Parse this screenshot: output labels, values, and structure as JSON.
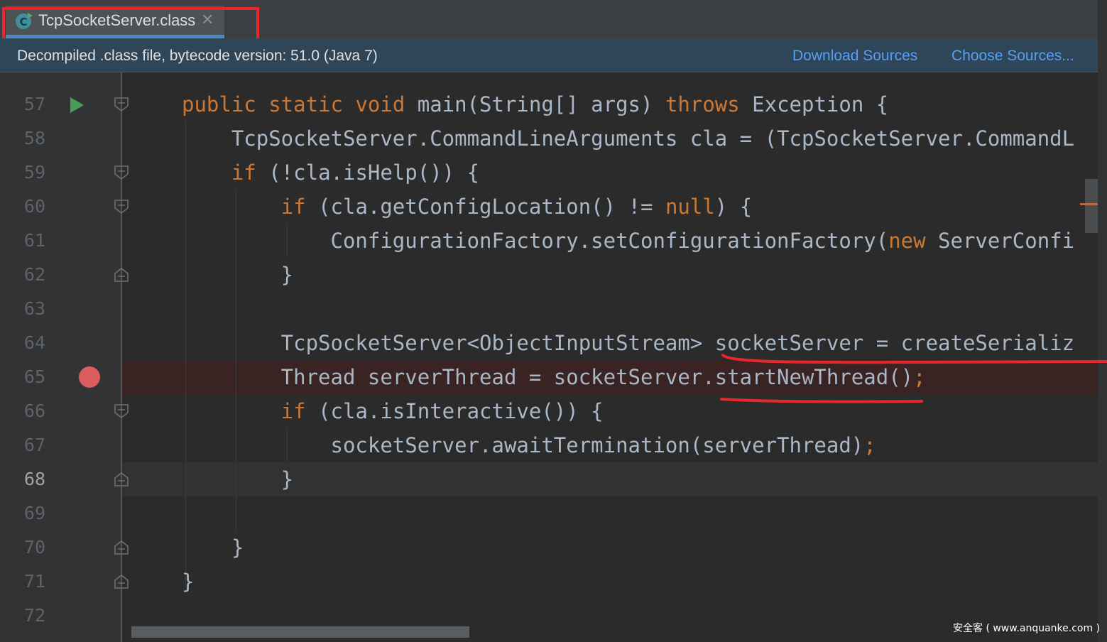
{
  "tab": {
    "title": "TcpSocketServer.class",
    "close_glyph": "✕",
    "icon": "java-class-icon"
  },
  "banner": {
    "text": "Decompiled .class file, bytecode version: 51.0 (Java 7)",
    "download_sources": "Download Sources",
    "choose_sources": "Choose Sources..."
  },
  "editor": {
    "current_line": "68",
    "breakpoint_line": "65",
    "lines": [
      {
        "num": "57",
        "tokens": [
          {
            "k": "kw",
            "t": "public "
          },
          {
            "k": "kw",
            "t": "static "
          },
          {
            "k": "kw",
            "t": "void "
          },
          {
            "k": "ident",
            "t": "main(String[] args) "
          },
          {
            "k": "kw",
            "t": "throws "
          },
          {
            "k": "ident",
            "t": "Exception {"
          }
        ]
      },
      {
        "num": "58",
        "tokens": [
          {
            "k": "ident",
            "t": "    TcpSocketServer.CommandLineArguments cla = (TcpSocketServer.CommandL"
          }
        ]
      },
      {
        "num": "59",
        "tokens": [
          {
            "k": "ident",
            "t": "    "
          },
          {
            "k": "kw",
            "t": "if "
          },
          {
            "k": "ident",
            "t": "(!cla.isHelp()) {"
          }
        ]
      },
      {
        "num": "60",
        "tokens": [
          {
            "k": "ident",
            "t": "        "
          },
          {
            "k": "kw",
            "t": "if "
          },
          {
            "k": "ident",
            "t": "(cla.getConfigLocation() != "
          },
          {
            "k": "kw",
            "t": "null"
          },
          {
            "k": "ident",
            "t": ") {"
          }
        ]
      },
      {
        "num": "61",
        "tokens": [
          {
            "k": "ident",
            "t": "            ConfigurationFactory.setConfigurationFactory("
          },
          {
            "k": "kw",
            "t": "new "
          },
          {
            "k": "ident",
            "t": "ServerConfi"
          }
        ]
      },
      {
        "num": "62",
        "tokens": [
          {
            "k": "ident",
            "t": "        }"
          }
        ]
      },
      {
        "num": "63",
        "tokens": []
      },
      {
        "num": "64",
        "tokens": [
          {
            "k": "ident",
            "t": "        TcpSocketServer<ObjectInputStream> socketServer = createSerializ"
          }
        ]
      },
      {
        "num": "65",
        "tokens": [
          {
            "k": "ident",
            "t": "        Thread serverThread = socketServer.startNewThread()"
          },
          {
            "k": "kw",
            "t": ";"
          }
        ]
      },
      {
        "num": "66",
        "tokens": [
          {
            "k": "ident",
            "t": "        "
          },
          {
            "k": "kw",
            "t": "if "
          },
          {
            "k": "ident",
            "t": "(cla.isInteractive()) {"
          }
        ]
      },
      {
        "num": "67",
        "tokens": [
          {
            "k": "ident",
            "t": "            socketServer.awaitTermination(serverThread)"
          },
          {
            "k": "kw",
            "t": ";"
          }
        ]
      },
      {
        "num": "68",
        "tokens": [
          {
            "k": "ident",
            "t": "        }"
          }
        ]
      },
      {
        "num": "69",
        "tokens": []
      },
      {
        "num": "70",
        "tokens": [
          {
            "k": "ident",
            "t": "    }"
          }
        ]
      },
      {
        "num": "71",
        "tokens": [
          {
            "k": "ident",
            "t": "}"
          }
        ]
      },
      {
        "num": "72",
        "tokens": []
      }
    ]
  },
  "watermark": "安全客 ( www.anquanke.com )",
  "colors": {
    "keyword": "#cc7832",
    "identifier": "#a9b7c6",
    "annotation_red": "#e8262d",
    "link": "#589df6",
    "breakpoint": "#db5c5c"
  }
}
